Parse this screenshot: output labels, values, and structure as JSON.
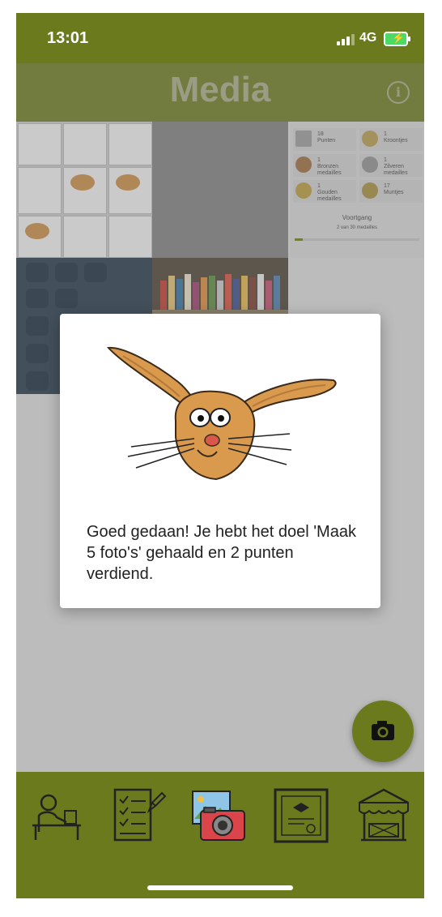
{
  "status_bar": {
    "time": "13:01",
    "network": "4G"
  },
  "header": {
    "title": "Media",
    "info_icon": "info-icon"
  },
  "prizes_preview": {
    "items": [
      {
        "count": "18",
        "label": "Punten"
      },
      {
        "count": "1",
        "label": "Kroontjes"
      },
      {
        "count": "1",
        "label": "Bronzen medailles"
      },
      {
        "count": "1",
        "label": "Zilveren medailles"
      },
      {
        "count": "1",
        "label": "Gouden medailles"
      },
      {
        "count": "17",
        "label": "Muntjes"
      }
    ],
    "progress_title": "Voortgang",
    "progress_text": "2 van 30 medailles",
    "progress_fraction": 0.0667
  },
  "dialog": {
    "message": "Goed gedaan! Je hebt het doel 'Maak 5 foto's' gehaald en 2 punten verdiend.",
    "image": "hare-illustration"
  },
  "camera_button": {
    "icon": "camera-icon"
  },
  "tab_bar": {
    "tabs": [
      {
        "icon": "student-desk-icon"
      },
      {
        "icon": "checklist-icon"
      },
      {
        "icon": "photo-camera-icon"
      },
      {
        "icon": "certificate-icon"
      },
      {
        "icon": "market-stall-icon"
      }
    ]
  },
  "colors": {
    "brand": "#6b7a1d",
    "title_dim": "#a9ab86"
  }
}
